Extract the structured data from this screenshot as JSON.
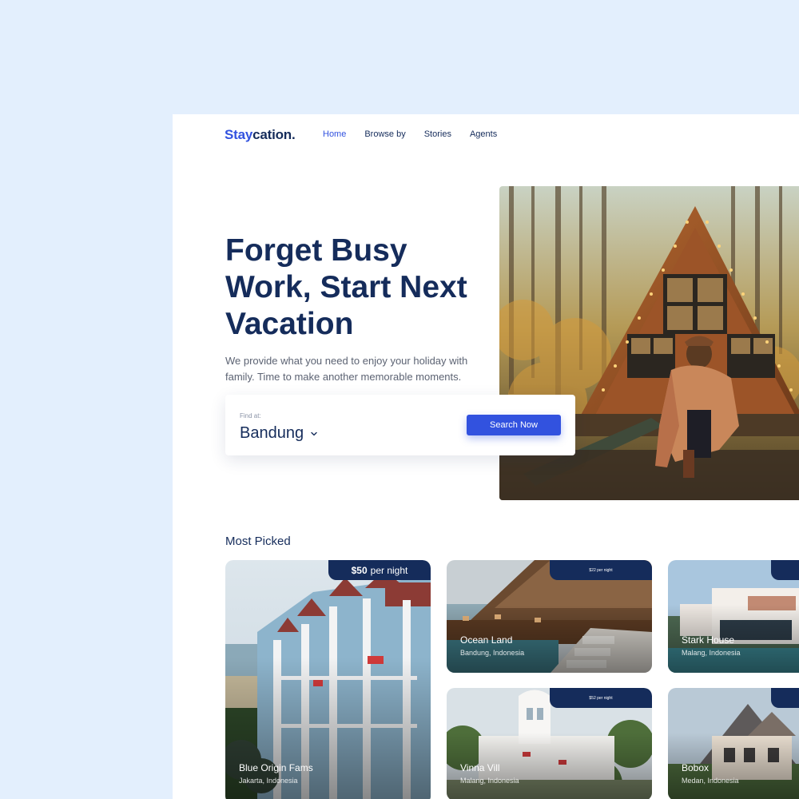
{
  "brand": {
    "part1": "Stay",
    "part2": "cation."
  },
  "nav": [
    {
      "label": "Home",
      "active": true
    },
    {
      "label": "Browse by",
      "active": false
    },
    {
      "label": "Stories",
      "active": false
    },
    {
      "label": "Agents",
      "active": false
    }
  ],
  "hero": {
    "title_line1": "Forget Busy",
    "title_line2": "Work, Start Next",
    "title_line3": "Vacation",
    "desc_line1": "We provide what you need to enjoy your  holiday with",
    "desc_line2": "family. Time to make another memorable moments."
  },
  "search": {
    "label": "Find at:",
    "value": "Bandung",
    "button": "Search Now"
  },
  "most_picked": {
    "title": "Most Picked",
    "featured": {
      "price": "$50",
      "unit": "per night",
      "name": "Blue Origin Fams",
      "location": "Jakarta, Indonesia"
    },
    "cards": [
      {
        "price": "$22 per night",
        "name": "Ocean Land",
        "location": "Bandung, Indonesia"
      },
      {
        "price": "",
        "name": "Stark House",
        "location": "Malang, Indonesia"
      },
      {
        "price": "$52 per night",
        "name": "Vinna Vill",
        "location": "Malang, Indonesia"
      },
      {
        "price": "",
        "name": "Bobox",
        "location": "Medan, Indonesia"
      }
    ]
  },
  "colors": {
    "primary": "#3252DF",
    "navy": "#152C5B",
    "background": "#E3EFFD"
  }
}
